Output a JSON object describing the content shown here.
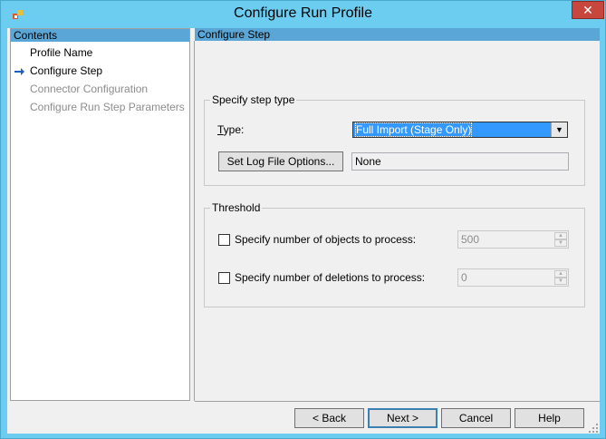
{
  "window": {
    "title": "Configure Run Profile",
    "close_symbol": "✕",
    "colors": {
      "titlebar": "#6ccdf0",
      "header": "#5aa7d7",
      "selection": "#3399ff",
      "close": "#c7463e"
    }
  },
  "sidebar": {
    "header": "Contents",
    "items": [
      {
        "label": "Profile Name",
        "state": "done"
      },
      {
        "label": "Configure Step",
        "state": "current",
        "icon": "arrow-right-icon"
      },
      {
        "label": "Connector Configuration",
        "state": "disabled"
      },
      {
        "label": "Configure Run Step Parameters",
        "state": "disabled"
      }
    ]
  },
  "main": {
    "header": "Configure Step",
    "step_type": {
      "legend": "Specify step type",
      "type_label": "Type:",
      "type_value": "Full Import (Stage Only)",
      "log_button": "Set Log File Options...",
      "log_value": "None"
    },
    "threshold": {
      "legend": "Threshold",
      "objects_label": "Specify number of objects to process:",
      "objects_value": "500",
      "deletions_label": "Specify number of deletions to process:",
      "deletions_value": "0"
    }
  },
  "footer": {
    "back": "< Back",
    "next": "Next >",
    "cancel": "Cancel",
    "help": "Help"
  }
}
